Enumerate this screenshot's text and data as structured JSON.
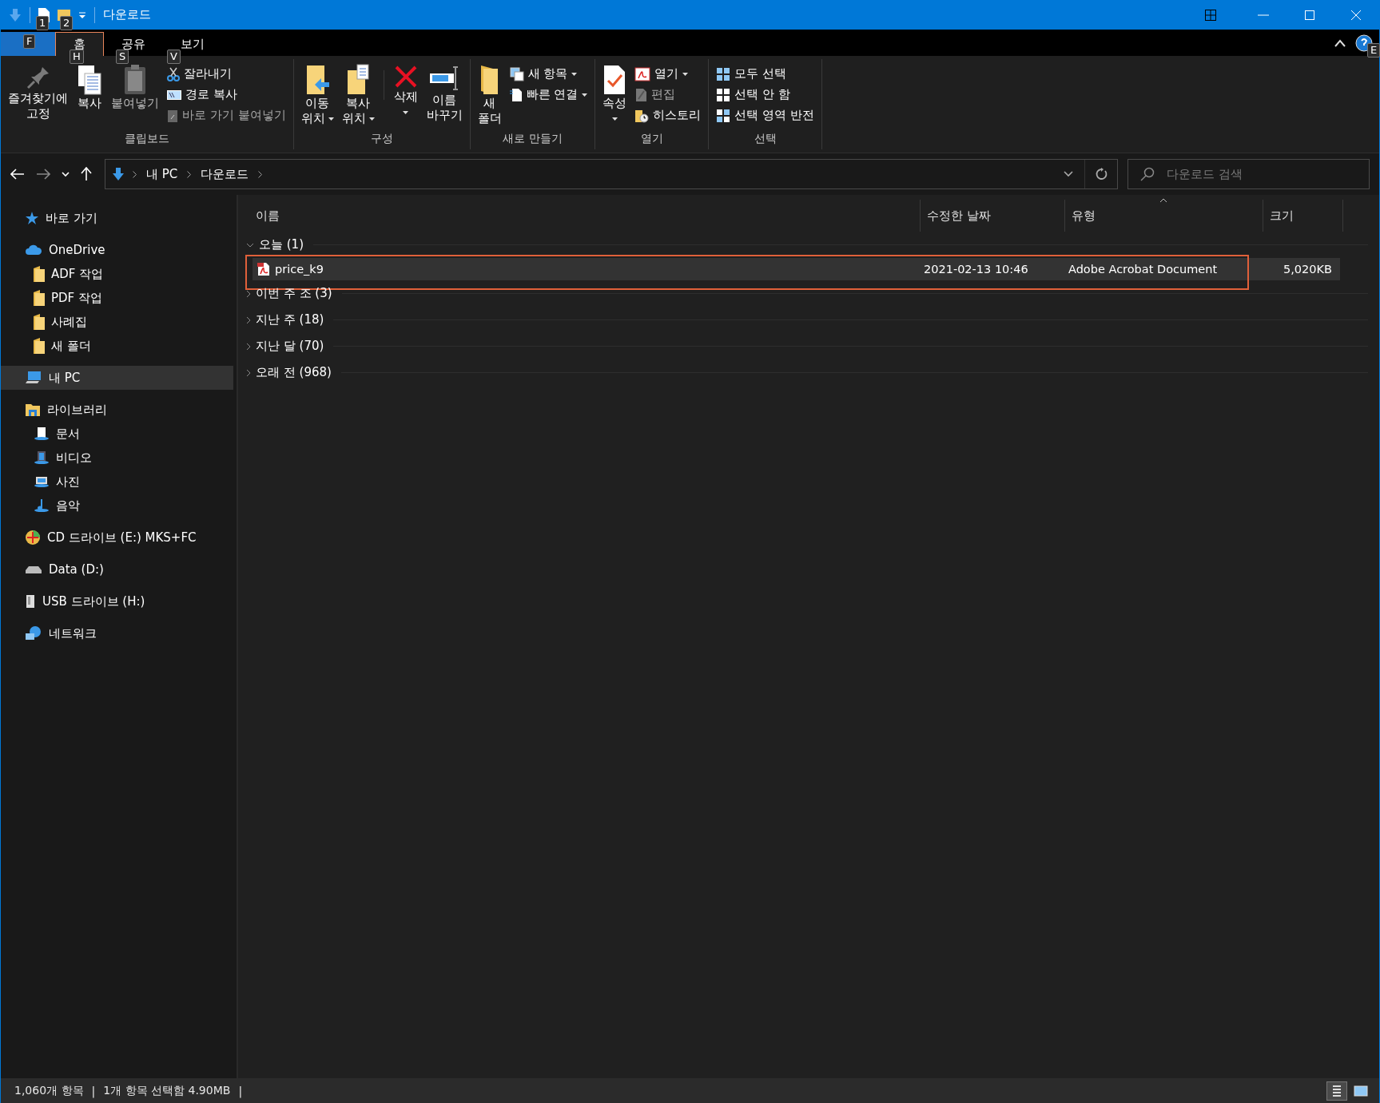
{
  "window": {
    "title": "다운로드",
    "keytips": [
      "1",
      "2"
    ]
  },
  "tabs": [
    {
      "kind": "file",
      "selected": false,
      "keytip": "F"
    },
    {
      "label": "홈",
      "kind": "tab",
      "selected": true,
      "keytip": "H"
    },
    {
      "label": "공유",
      "kind": "tab",
      "selected": false,
      "keytip": "S"
    },
    {
      "label": "보기",
      "kind": "tab",
      "selected": false,
      "keytip": "V"
    }
  ],
  "help_keytip": "E",
  "ribbon": {
    "groups": [
      {
        "label": "클립보드",
        "items": [
          {
            "kind": "large",
            "lines": [
              "즐겨찾기에",
              "고정"
            ],
            "dropdown": false,
            "disabled": false
          },
          {
            "kind": "large",
            "lines": [
              "복사"
            ],
            "dropdown": false,
            "disabled": false
          },
          {
            "kind": "large",
            "lines": [
              "붙여넣기"
            ],
            "dropdown": false,
            "disabled": true
          },
          {
            "kind": "small",
            "lines": [
              "잘라내기"
            ],
            "dropdown": false,
            "disabled": false
          },
          {
            "kind": "small",
            "lines": [
              "경로 복사"
            ],
            "dropdown": false,
            "disabled": false
          },
          {
            "kind": "small",
            "lines": [
              "바로 가기 붙여넣기"
            ],
            "dropdown": false,
            "disabled": true
          }
        ]
      },
      {
        "label": "구성",
        "items": [
          {
            "kind": "large",
            "lines": [
              "이동",
              "위치"
            ],
            "dropdown": true,
            "disabled": false
          },
          {
            "kind": "large",
            "lines": [
              "복사",
              "위치"
            ],
            "dropdown": true,
            "disabled": false
          },
          {
            "kind": "large",
            "lines": [
              "삭제"
            ],
            "dropdown": true,
            "disabled": false
          },
          {
            "kind": "large",
            "lines": [
              "이름",
              "바꾸기"
            ],
            "dropdown": false,
            "disabled": false
          }
        ]
      },
      {
        "label": "새로 만들기",
        "items": [
          {
            "kind": "large",
            "lines": [
              "새",
              "폴더"
            ],
            "dropdown": false,
            "disabled": false
          },
          {
            "kind": "small",
            "lines": [
              "새 항목"
            ],
            "dropdown": true,
            "disabled": false
          },
          {
            "kind": "small",
            "lines": [
              "빠른 연결"
            ],
            "dropdown": true,
            "disabled": false
          }
        ]
      },
      {
        "label": "열기",
        "items": [
          {
            "kind": "large",
            "lines": [
              "속성"
            ],
            "dropdown": true,
            "disabled": false
          },
          {
            "kind": "small",
            "lines": [
              "열기"
            ],
            "dropdown": true,
            "disabled": false
          },
          {
            "kind": "small",
            "lines": [
              "편집"
            ],
            "dropdown": false,
            "disabled": true
          },
          {
            "kind": "small",
            "lines": [
              "히스토리"
            ],
            "dropdown": false,
            "disabled": false
          }
        ]
      },
      {
        "label": "선택",
        "items": [
          {
            "kind": "small",
            "lines": [
              "모두 선택"
            ],
            "dropdown": false,
            "disabled": false
          },
          {
            "kind": "small",
            "lines": [
              "선택 안 함"
            ],
            "dropdown": false,
            "disabled": false
          },
          {
            "kind": "small",
            "lines": [
              "선택 영역 반전"
            ],
            "dropdown": false,
            "disabled": false
          }
        ]
      }
    ]
  },
  "address": {
    "crumbs": [
      "내 PC",
      "다운로드"
    ],
    "search_placeholder": "다운로드 검색"
  },
  "sidebar": {
    "items": [
      {
        "label": "바로 가기",
        "selected": false
      },
      {
        "label": "OneDrive",
        "selected": false,
        "children": [
          {
            "label": "ADF 작업",
            "selected": false
          },
          {
            "label": "PDF 작업",
            "selected": false
          },
          {
            "label": "사례집",
            "selected": false
          },
          {
            "label": "새 폴더",
            "selected": false
          }
        ]
      },
      {
        "label": "내 PC",
        "selected": true
      },
      {
        "label": "라이브러리",
        "selected": false,
        "children": [
          {
            "label": "문서",
            "selected": false
          },
          {
            "label": "비디오",
            "selected": false
          },
          {
            "label": "사진",
            "selected": false
          },
          {
            "label": "음악",
            "selected": false
          }
        ]
      },
      {
        "label": "CD 드라이브 (E:) MKS+FC",
        "selected": false
      },
      {
        "label": "Data (D:)",
        "selected": false
      },
      {
        "label": "USB 드라이브 (H:)",
        "selected": false
      },
      {
        "label": "네트워크",
        "selected": false
      }
    ]
  },
  "table": {
    "columns": [
      "이름",
      "수정한 날짜",
      "유형",
      "크기"
    ],
    "groups": [
      {
        "label": "오늘 (1)",
        "expanded": true,
        "highlighted": true,
        "rows": [
          {
            "name": "price_k9",
            "date": "2021-02-13 10:46",
            "type": "Adobe Acrobat Document",
            "size": "5,020KB",
            "selected": true
          }
        ]
      },
      {
        "label": "이번 주 조 (3)",
        "expanded": false,
        "highlighted": false
      },
      {
        "label": "지난 주 (18)",
        "expanded": false,
        "highlighted": false
      },
      {
        "label": "지난 달 (70)",
        "expanded": false,
        "highlighted": false
      },
      {
        "label": "오래 전 (968)",
        "expanded": false,
        "highlighted": false
      }
    ]
  },
  "status_bar": {
    "texts": [
      "1,060개 항목",
      "|",
      "1개 항목 선택함 4.90MB",
      "|"
    ],
    "views": [
      {
        "selected": true
      },
      {
        "selected": false
      }
    ]
  }
}
